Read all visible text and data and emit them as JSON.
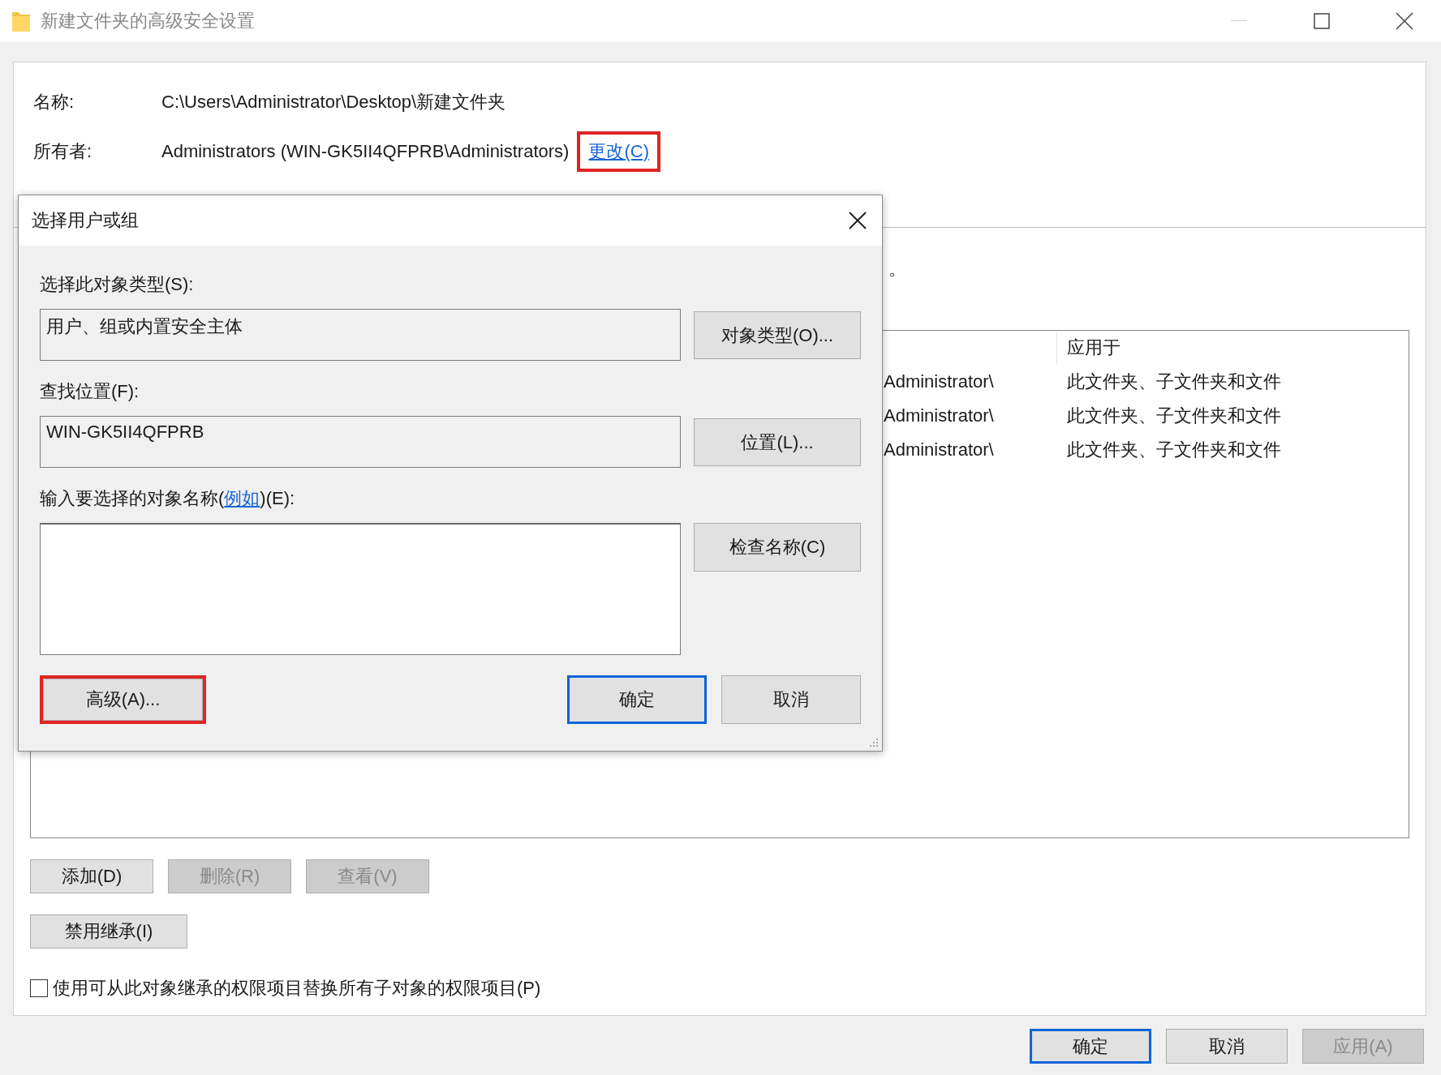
{
  "window": {
    "title": "新建文件夹的高级安全设置"
  },
  "info": [
    {
      "label": "名称:",
      "value": "C:\\Users\\Administrator\\Desktop\\新建文件夹"
    },
    {
      "label": "所有者:",
      "value": "Administrators (WIN-GK5II4QFPRB\\Administrators)",
      "link": {
        "label": "更改(C)",
        "highlighted": true
      }
    }
  ],
  "description_tail": "。",
  "permissions_table": {
    "header_applies_to": "应用于",
    "rows": [
      {
        "column_2": "Administrator\\",
        "applies_to": "此文件夹、子文件夹和文件"
      },
      {
        "column_2": "Administrator\\",
        "applies_to": "此文件夹、子文件夹和文件"
      },
      {
        "column_2": "Administrator\\",
        "applies_to": "此文件夹、子文件夹和文件"
      }
    ]
  },
  "entry_buttons": [
    {
      "label": "添加(D)",
      "disabled": false
    },
    {
      "label": "删除(R)",
      "disabled": true
    },
    {
      "label": "查看(V)",
      "disabled": true
    }
  ],
  "inheritance_button": {
    "label": "禁用继承(I)"
  },
  "replace_checkbox": {
    "label": "使用可从此对象继承的权限项目替换所有子对象的权限项目(P)",
    "checked": false
  },
  "footer_buttons": [
    {
      "label": "确定",
      "default": true,
      "disabled": false
    },
    {
      "label": "取消",
      "default": false,
      "disabled": false
    },
    {
      "label": "应用(A)",
      "default": false,
      "disabled": true
    }
  ],
  "dialog": {
    "title": "选择用户或组",
    "object_type": {
      "label": "选择此对象类型(S):",
      "value": "用户、组或内置安全主体",
      "button": "对象类型(O)..."
    },
    "location": {
      "label": "查找位置(F):",
      "value": "WIN-GK5II4QFPRB",
      "button": "位置(L)..."
    },
    "names": {
      "label_before": "输入要选择的对象名称(",
      "link": "例如",
      "label_after": ")(E):",
      "button": "检查名称(C)"
    },
    "buttons": [
      {
        "label": "高级(A)...",
        "default": false,
        "highlighted": true
      },
      {
        "label": "确定",
        "default": true,
        "highlighted": false
      },
      {
        "label": "取消",
        "default": false,
        "highlighted": false
      }
    ]
  }
}
